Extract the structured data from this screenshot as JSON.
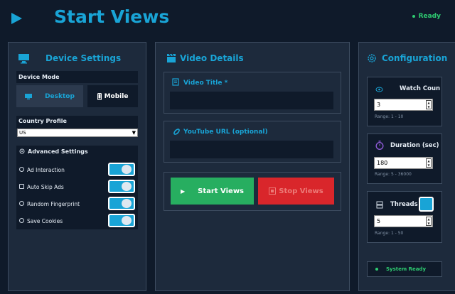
{
  "header": {
    "title": "Start Views",
    "status": "Ready"
  },
  "device_settings": {
    "title": "Device Settings",
    "mode_label": "Device Mode",
    "desktop_label": "Desktop",
    "mobile_label": "Mobile",
    "country_label": "Country Profile",
    "country_value": "US",
    "advanced_label": "Advanced Settings",
    "toggles": [
      {
        "label": "Ad Interaction",
        "on": true
      },
      {
        "label": "Auto Skip Ads",
        "on": true
      },
      {
        "label": "Random Fingerprint",
        "on": true
      },
      {
        "label": "Save Cookies",
        "on": true
      }
    ]
  },
  "video_details": {
    "title": "Video Details",
    "video_title_label": "Video Title *",
    "video_title_value": "",
    "url_label": "YouTube URL (optional)",
    "url_value": "",
    "start_label": "Start Views",
    "stop_label": "Stop Views"
  },
  "configuration": {
    "title": "Configuration",
    "watch_count_label": "Watch Coun",
    "watch_count_value": "3",
    "watch_count_range": "Range: 1 - 10",
    "duration_label": "Duration (sec)",
    "duration_value": "180",
    "duration_range": "Range: 5 - 36000",
    "threads_label": "Threads",
    "threads_value": "5",
    "threads_range": "Range: 1 - 50",
    "system_status": "System Ready"
  },
  "colors": {
    "accent": "#19a4d6",
    "success": "#27ae60",
    "danger": "#d9262b",
    "background": "#0f1a2a",
    "panel": "#1d2a3c"
  }
}
